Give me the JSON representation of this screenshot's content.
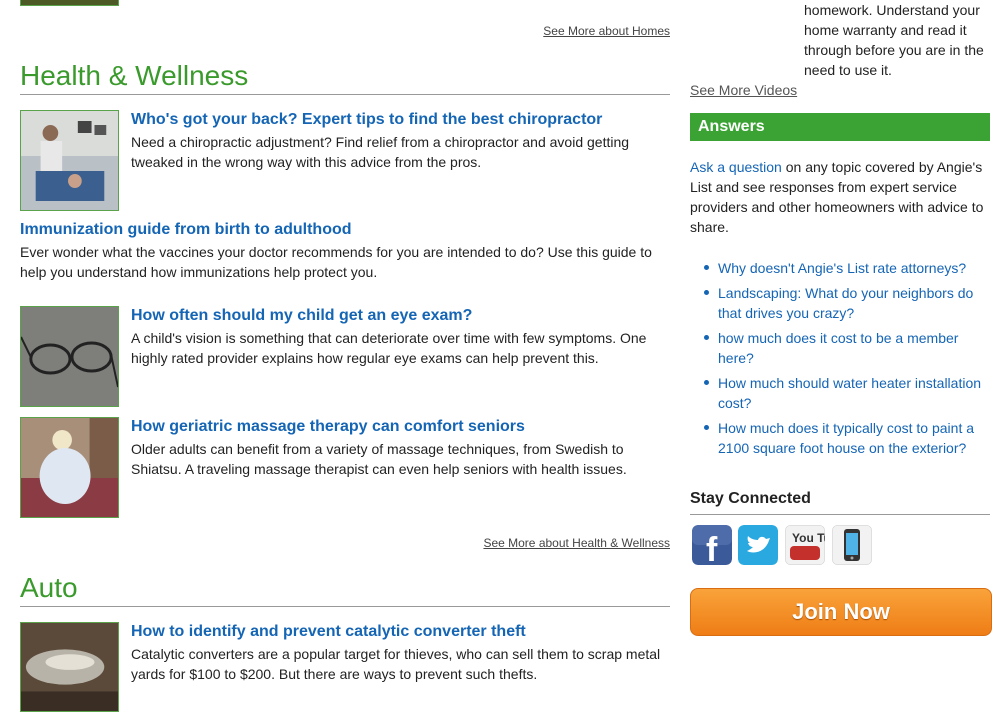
{
  "homes": {
    "see_more": "See More about Homes"
  },
  "health": {
    "title": "Health & Wellness",
    "articles": [
      {
        "title": "Who's got your back? Expert tips to find the best chiropractor",
        "text": "Need a chiropractic adjustment? Find relief from a chiropractor and avoid getting tweaked in the wrong way with this advice from the pros."
      },
      {
        "title": "Immunization guide from birth to adulthood",
        "text": "Ever wonder what the vaccines your doctor recommends for you are intended to do? Use this guide to help you understand how immunizations help protect you."
      },
      {
        "title": "How often should my child get an eye exam?",
        "text": "A child's vision is something that can deteriorate over time with few symptoms. One highly rated provider explains how regular eye exams can help prevent this."
      },
      {
        "title": "How geriatric massage therapy can comfort seniors",
        "text": "Older adults can benefit from a variety of massage techniques, from Swedish to Shiatsu. A traveling massage therapist can even help seniors with health issues."
      }
    ],
    "see_more": "See More about Health & Wellness"
  },
  "auto": {
    "title": "Auto",
    "articles": [
      {
        "title": "How to identify and prevent catalytic converter theft",
        "text": "Catalytic converters are a popular target for thieves, who can sell them to scrap metal yards for $100 to $200. But there are ways to prevent such thefts."
      }
    ]
  },
  "sidebar": {
    "video_text": "homework. Understand your home warranty and read it through before you are in the need to use it.",
    "see_more_videos": "See More Videos",
    "answers": {
      "heading": "Answers",
      "ask_link": "Ask a question",
      "intro_rest": " on any topic covered by Angie's List and see responses from expert service providers and other homeowners with advice to share.",
      "questions": [
        "Why doesn't Angie's List rate attorneys?",
        "Landscaping: What do your neighbors do that drives you crazy?",
        "how much does it cost to be a member here?",
        "How much should water heater installation cost?",
        "How much does it typically cost to paint a 2100 square foot house on the exterior?"
      ]
    },
    "stay_connected": "Stay Connected",
    "social": [
      "facebook-icon",
      "twitter-icon",
      "youtube-icon",
      "mobile-app-icon"
    ],
    "youtube_label": "You Tube",
    "join_now": "Join Now"
  },
  "colors": {
    "section_green": "#3a9a2c",
    "link_blue": "#1565b5",
    "answers_bar": "#3ba334",
    "join_orange": "#ef7d16"
  }
}
